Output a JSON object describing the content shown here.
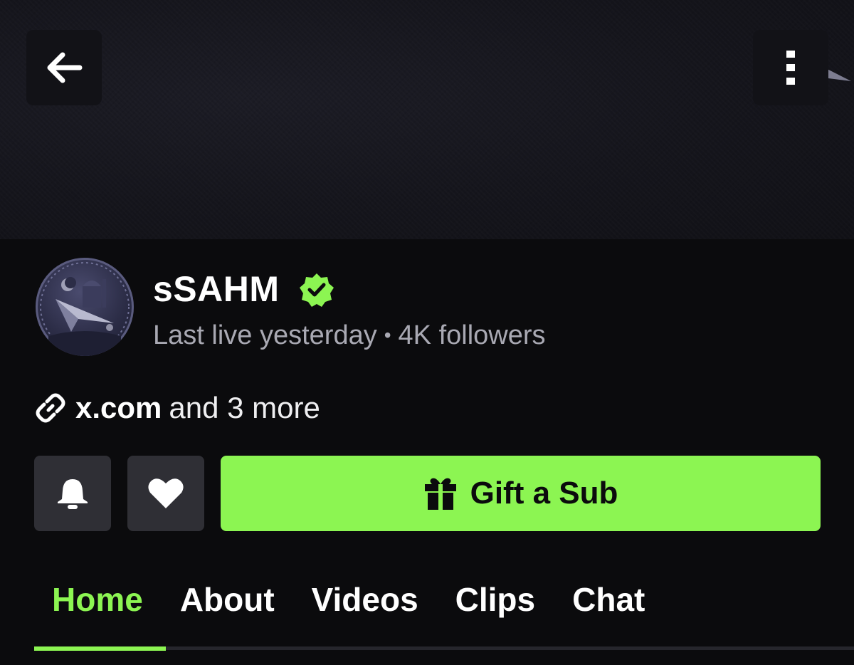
{
  "header": {
    "back_icon": "arrow-left-icon",
    "more_icon": "vertical-dots-icon"
  },
  "channel": {
    "name": "sSAHM",
    "verified_icon": "verified-badge-icon",
    "last_live": "Last live yesterday",
    "separator": "•",
    "followers": "4K followers"
  },
  "links": {
    "icon": "link-icon",
    "primary": "x.com",
    "more": "and 3 more"
  },
  "actions": {
    "notify_icon": "bell-icon",
    "follow_icon": "heart-icon",
    "gift_icon": "gift-icon",
    "gift_label": "Gift a Sub"
  },
  "tabs": [
    {
      "label": "Home",
      "active": true
    },
    {
      "label": "About"
    },
    {
      "label": "Videos"
    },
    {
      "label": "Clips"
    },
    {
      "label": "Chat"
    }
  ],
  "colors": {
    "accent": "#8cf552",
    "background": "#0b0b0d",
    "button_dark": "#2f2f35",
    "muted_text": "#a9a9b3"
  }
}
